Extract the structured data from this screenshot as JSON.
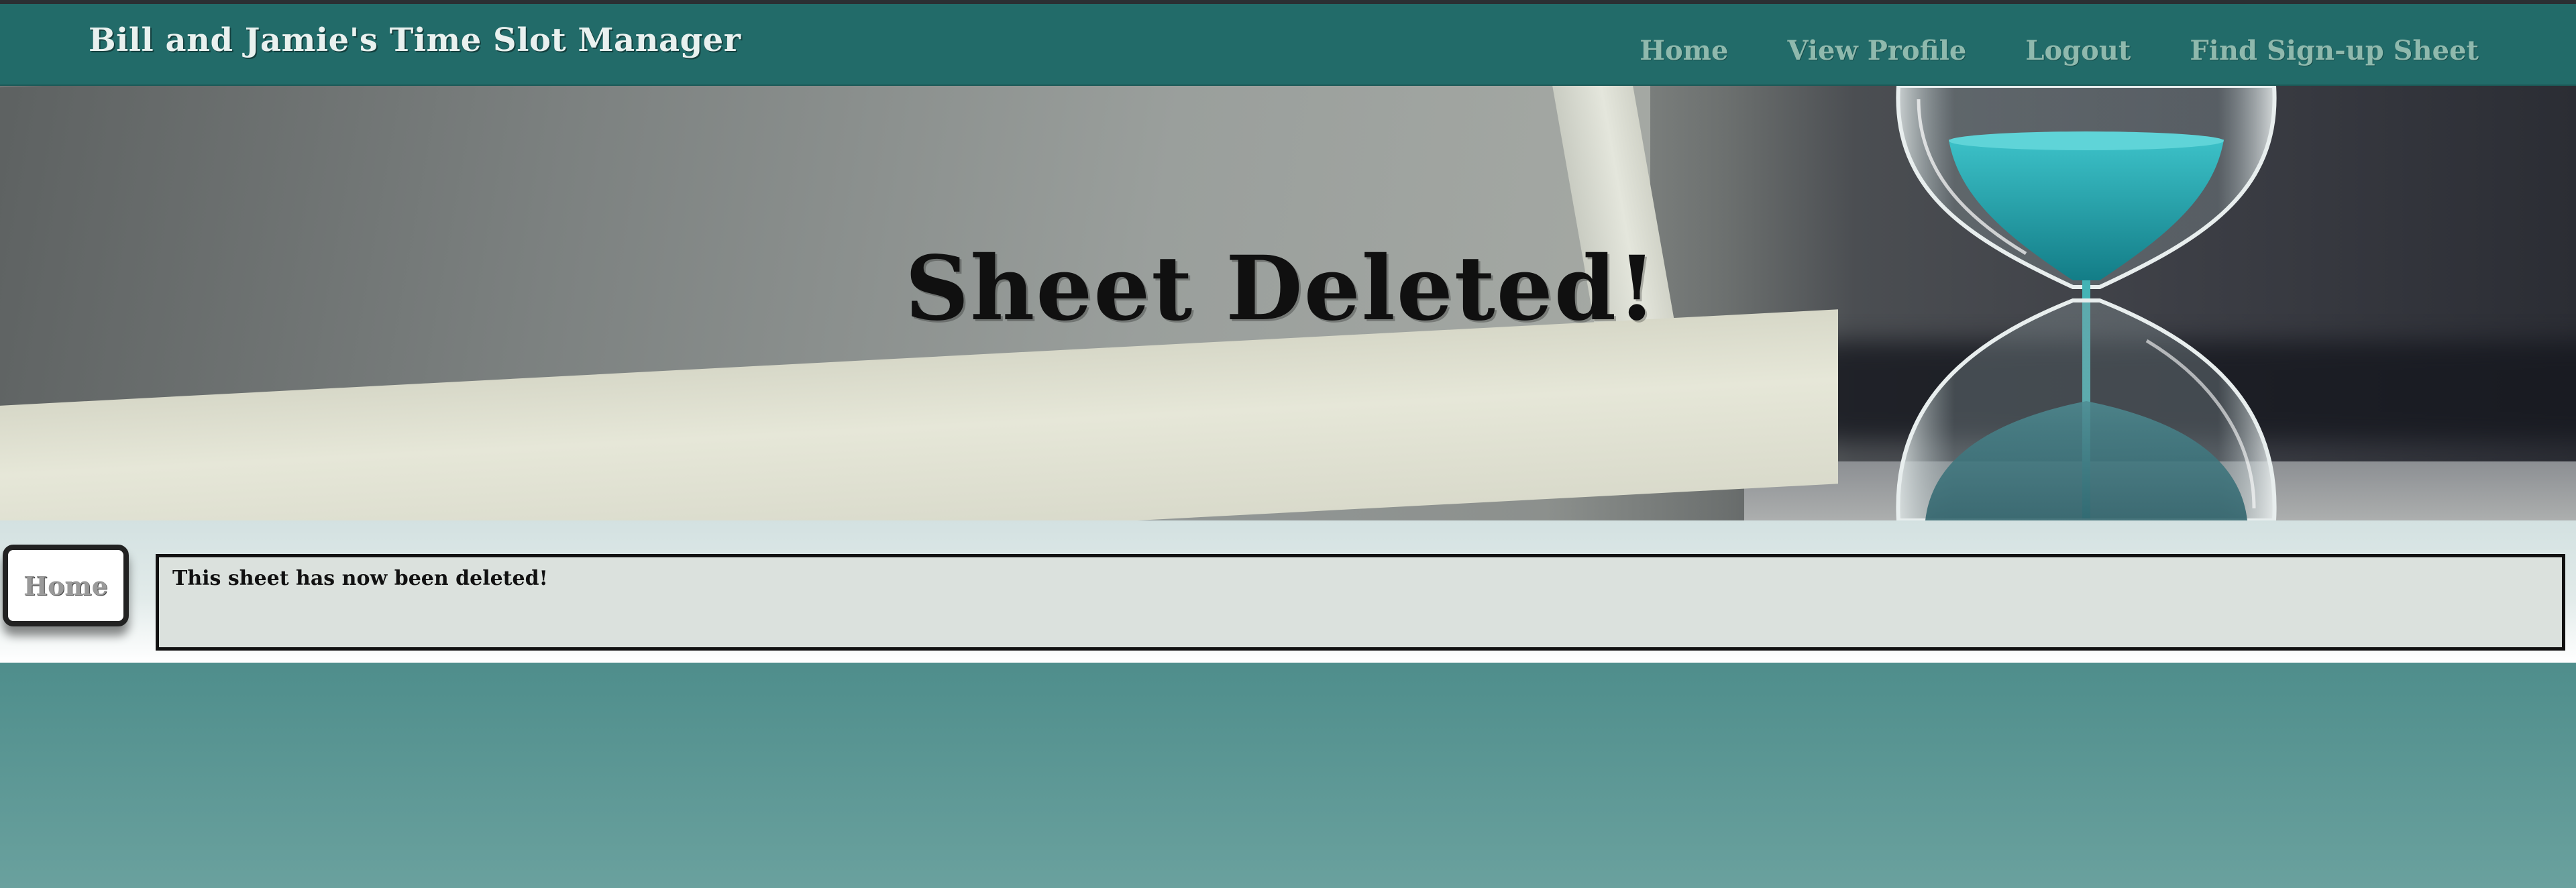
{
  "header": {
    "brand": "Bill and Jamie's Time Slot Manager",
    "nav": [
      {
        "label": "Home"
      },
      {
        "label": "View Profile"
      },
      {
        "label": "Logout"
      },
      {
        "label": "Find Sign-up Sheet"
      }
    ]
  },
  "hero": {
    "title": "Sheet Deleted!"
  },
  "sidebar": {
    "home_label": "Home"
  },
  "main": {
    "message": "This sheet has now been deleted!"
  },
  "colors": {
    "navbar": "#226b69",
    "nav_link": "#8fb9ad",
    "brand_text": "#e9f1ef",
    "hourglass_sand": "#1fa3ad"
  }
}
